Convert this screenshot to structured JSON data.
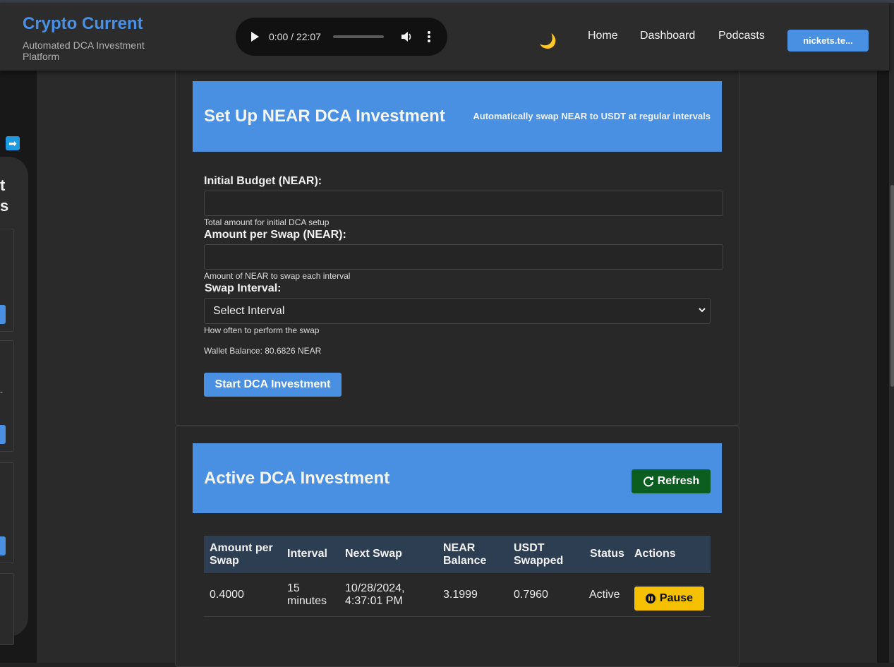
{
  "header": {
    "brand_title": "Crypto Current",
    "brand_subtitle": "Automated DCA Investment Platform",
    "audio": {
      "time": "0:00 / 22:07"
    },
    "theme_icon": "moon-icon",
    "nav": [
      "Home",
      "Dashboard",
      "Podcasts"
    ],
    "wallet_button": "nickets.te..."
  },
  "sidebar": {
    "arrow_icon": "arrow-right-icon",
    "partial_text_1": "t",
    "partial_text_2": "s",
    "partial_text_3": "-"
  },
  "setup": {
    "title": "Set Up NEAR DCA Investment",
    "subtitle": "Automatically swap NEAR to USDT at regular intervals",
    "initial_budget_label": "Initial Budget (NEAR):",
    "initial_budget_hint": "Total amount for initial DCA setup",
    "amount_per_swap_label": "Amount per Swap (NEAR):",
    "amount_per_swap_hint": "Amount of NEAR to swap each interval",
    "swap_interval_label": "Swap Interval:",
    "swap_interval_selected": "Select Interval",
    "swap_interval_hint": "How often to perform the swap",
    "wallet_balance": "Wallet Balance: 80.6826 NEAR",
    "start_button": "Start DCA Investment"
  },
  "active": {
    "title": "Active DCA Investment",
    "refresh_button": "Refresh",
    "columns": {
      "amount_per_swap": "Amount per Swap",
      "interval": "Interval",
      "next_swap": "Next Swap",
      "near_balance": "NEAR Balance",
      "usdt_swapped": "USDT Swapped",
      "status": "Status",
      "actions": "Actions"
    },
    "row": {
      "amount_per_swap": "0.4000",
      "interval": "15 minutes",
      "next_swap": "10/28/2024, 4:37:01 PM",
      "near_balance": "3.1999",
      "usdt_swapped": "0.7960",
      "status": "Active",
      "action_button": "Pause"
    }
  },
  "colors": {
    "accent": "#4a90e2",
    "refresh": "#0b5e20",
    "pause": "#f5c000",
    "table_header": "#2d3e52"
  }
}
